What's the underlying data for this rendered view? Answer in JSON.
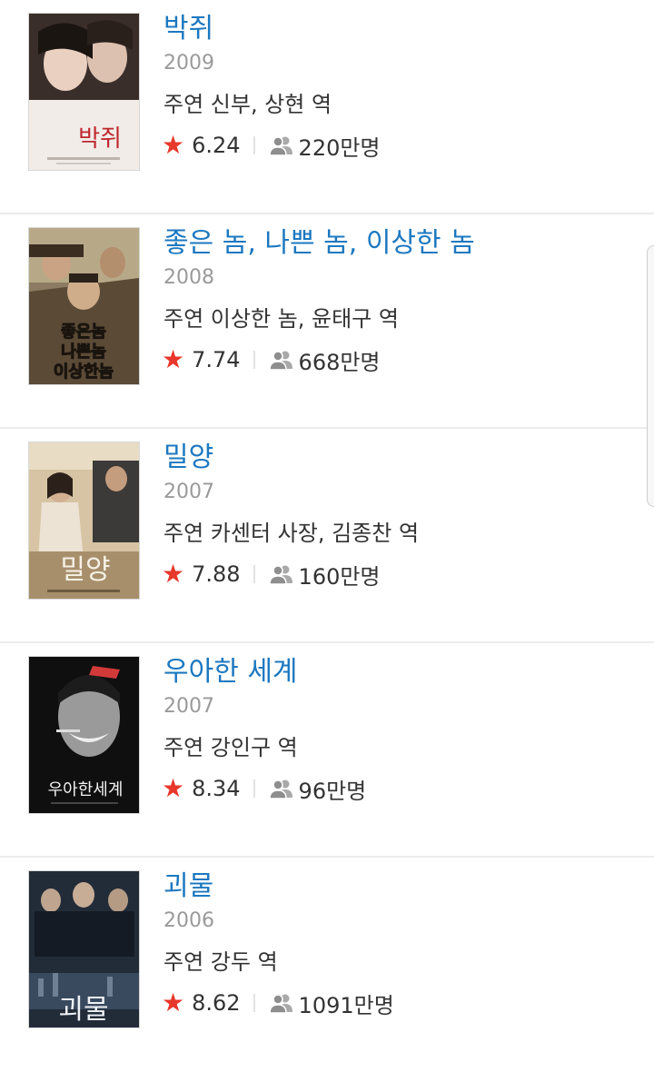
{
  "movies": [
    {
      "title": "박쥐",
      "year": "2009",
      "role": "주연 신부, 상현 역",
      "rating": "6.24",
      "audience": "220만명",
      "poster_text": "박쥐",
      "poster_colors": {
        "bg": "#e9e3de",
        "accent": "#c0262d"
      }
    },
    {
      "title": "좋은 놈, 나쁜 놈, 이상한 놈",
      "year": "2008",
      "role": "주연 이상한 놈, 윤태구 역",
      "rating": "7.74",
      "audience": "668만명",
      "poster_text": "좋은놈 나쁜놈 이상한놈",
      "poster_colors": {
        "bg": "#8a7a62",
        "accent": "#2a2118"
      }
    },
    {
      "title": "밀양",
      "year": "2007",
      "role": "주연 카센터 사장, 김종찬 역",
      "rating": "7.88",
      "audience": "160만명",
      "poster_text": "밀양",
      "poster_colors": {
        "bg": "#d9c7a7",
        "accent": "#4a3a2a"
      }
    },
    {
      "title": "우아한 세계",
      "year": "2007",
      "role": "주연 강인구 역",
      "rating": "8.34",
      "audience": "96만명",
      "poster_text": "우아한세계",
      "poster_colors": {
        "bg": "#111111",
        "accent": "#c8202a"
      }
    },
    {
      "title": "괴물",
      "year": "2006",
      "role": "주연 강두 역",
      "rating": "8.62",
      "audience": "1091만명",
      "poster_text": "괴물",
      "poster_colors": {
        "bg": "#283444",
        "accent": "#d9dde6"
      }
    }
  ],
  "icons": {
    "star": "star-icon",
    "people": "people-icon"
  },
  "colors": {
    "title": "#1c78c0",
    "star": "#e8372b",
    "year": "#9a9a9a",
    "text": "#333333"
  }
}
